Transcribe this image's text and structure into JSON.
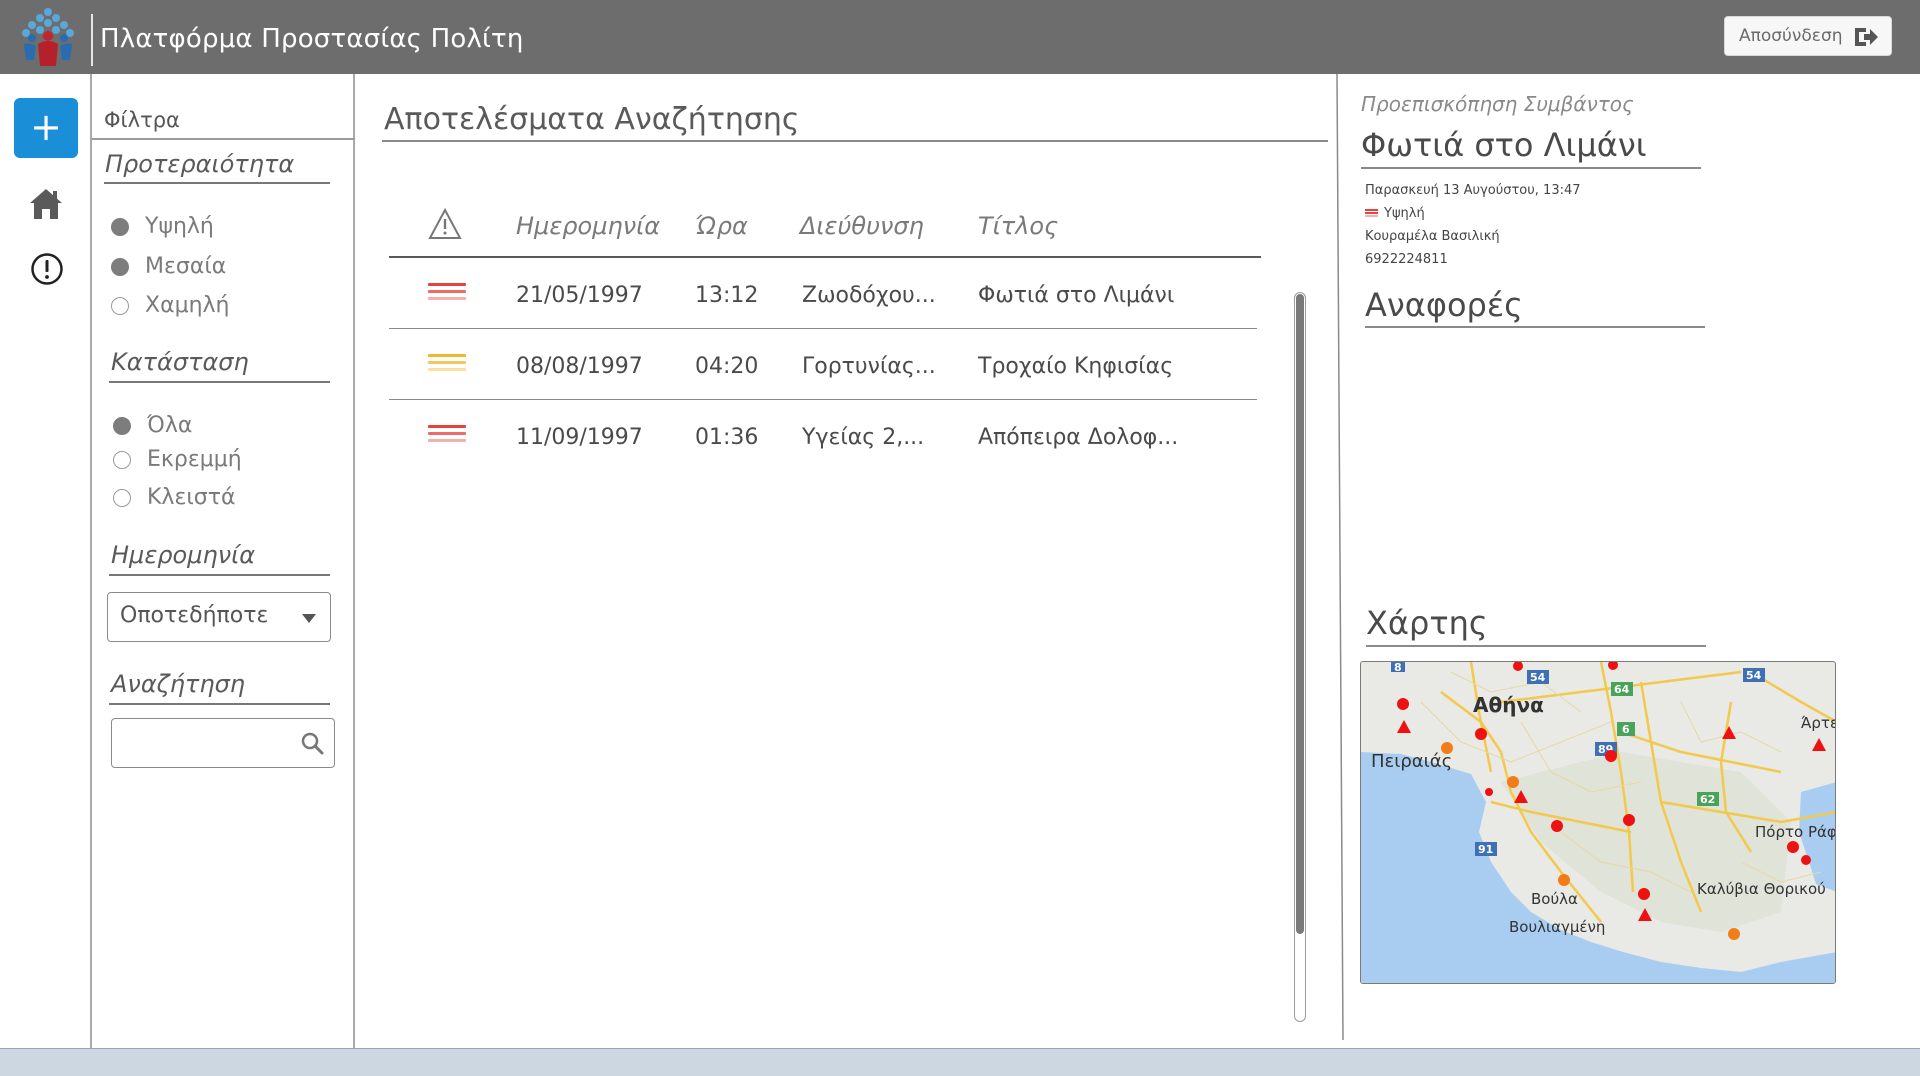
{
  "header": {
    "app_title": "Πλατφόρμα Προστασίας Πολίτη",
    "logout_label": "Αποσύνδεση"
  },
  "rail": {
    "add_label": "+"
  },
  "filters": {
    "title": "Φίλτρα",
    "priority": {
      "heading": "Προτεραιότητα",
      "options": [
        {
          "label": "Υψηλή",
          "selected": true
        },
        {
          "label": "Μεσαία",
          "selected": true
        },
        {
          "label": "Χαμηλή",
          "selected": false
        }
      ]
    },
    "status": {
      "heading": "Κατάσταση",
      "options": [
        {
          "label": "Όλα",
          "selected": true
        },
        {
          "label": "Εκρεμμή",
          "selected": false
        },
        {
          "label": "Κλειστά",
          "selected": false
        }
      ]
    },
    "date": {
      "heading": "Ημερομηνία",
      "selected": "Οποτεδήποτε"
    },
    "search": {
      "heading": "Αναζήτηση",
      "value": ""
    }
  },
  "results": {
    "title": "Αποτελέσματα Αναζήτησης",
    "columns": [
      "Ημερομηνία",
      "Ώρα",
      "Διεύθυνση",
      "Τίτλος"
    ],
    "rows": [
      {
        "priority": "high",
        "priority_color": "#e8423f",
        "date": "21/05/1997",
        "time": "13:12",
        "address": "Ζωοδόχου...",
        "title": "Φωτιά στο Λιμάνι"
      },
      {
        "priority": "medium",
        "priority_color": "#f5b528",
        "date": "08/08/1997",
        "time": "04:20",
        "address": "Γορτυνίας...",
        "title": "Τροχαίο Κηφισίας"
      },
      {
        "priority": "high",
        "priority_color": "#e8423f",
        "date": "11/09/1997",
        "time": "01:36",
        "address": "Υγείας 2,...",
        "title": "Απόπειρα Δολοφ..."
      }
    ]
  },
  "preview": {
    "label": "Προεπισκόπηση Συμβάντος",
    "title": "Φωτιά στο Λιμάνι",
    "datetime": "Παρασκευή 13 Αυγούστου, 13:47",
    "priority": "Υψηλή",
    "reporter": "Κουραμέλα Βασιλική",
    "phone": "6922224811",
    "reports_heading": "Αναφορές",
    "map_heading": "Χάρτης",
    "map": {
      "labels": [
        "Αθήνα",
        "Πειραιάς",
        "Βούλα",
        "Βουλιαγμένη",
        "Καλύβια Θορικού",
        "Πόρτο Ράφτη",
        "Άρτεμη"
      ],
      "road_numbers": [
        "8",
        "54",
        "54",
        "64",
        "6",
        "89",
        "62",
        "91"
      ]
    }
  },
  "colors": {
    "accent": "#1a8fd8",
    "header_bg": "#6d6d6d",
    "high_priority": "#e8423f",
    "medium_priority": "#f5b528",
    "statusbar": "#cdd7e2"
  }
}
